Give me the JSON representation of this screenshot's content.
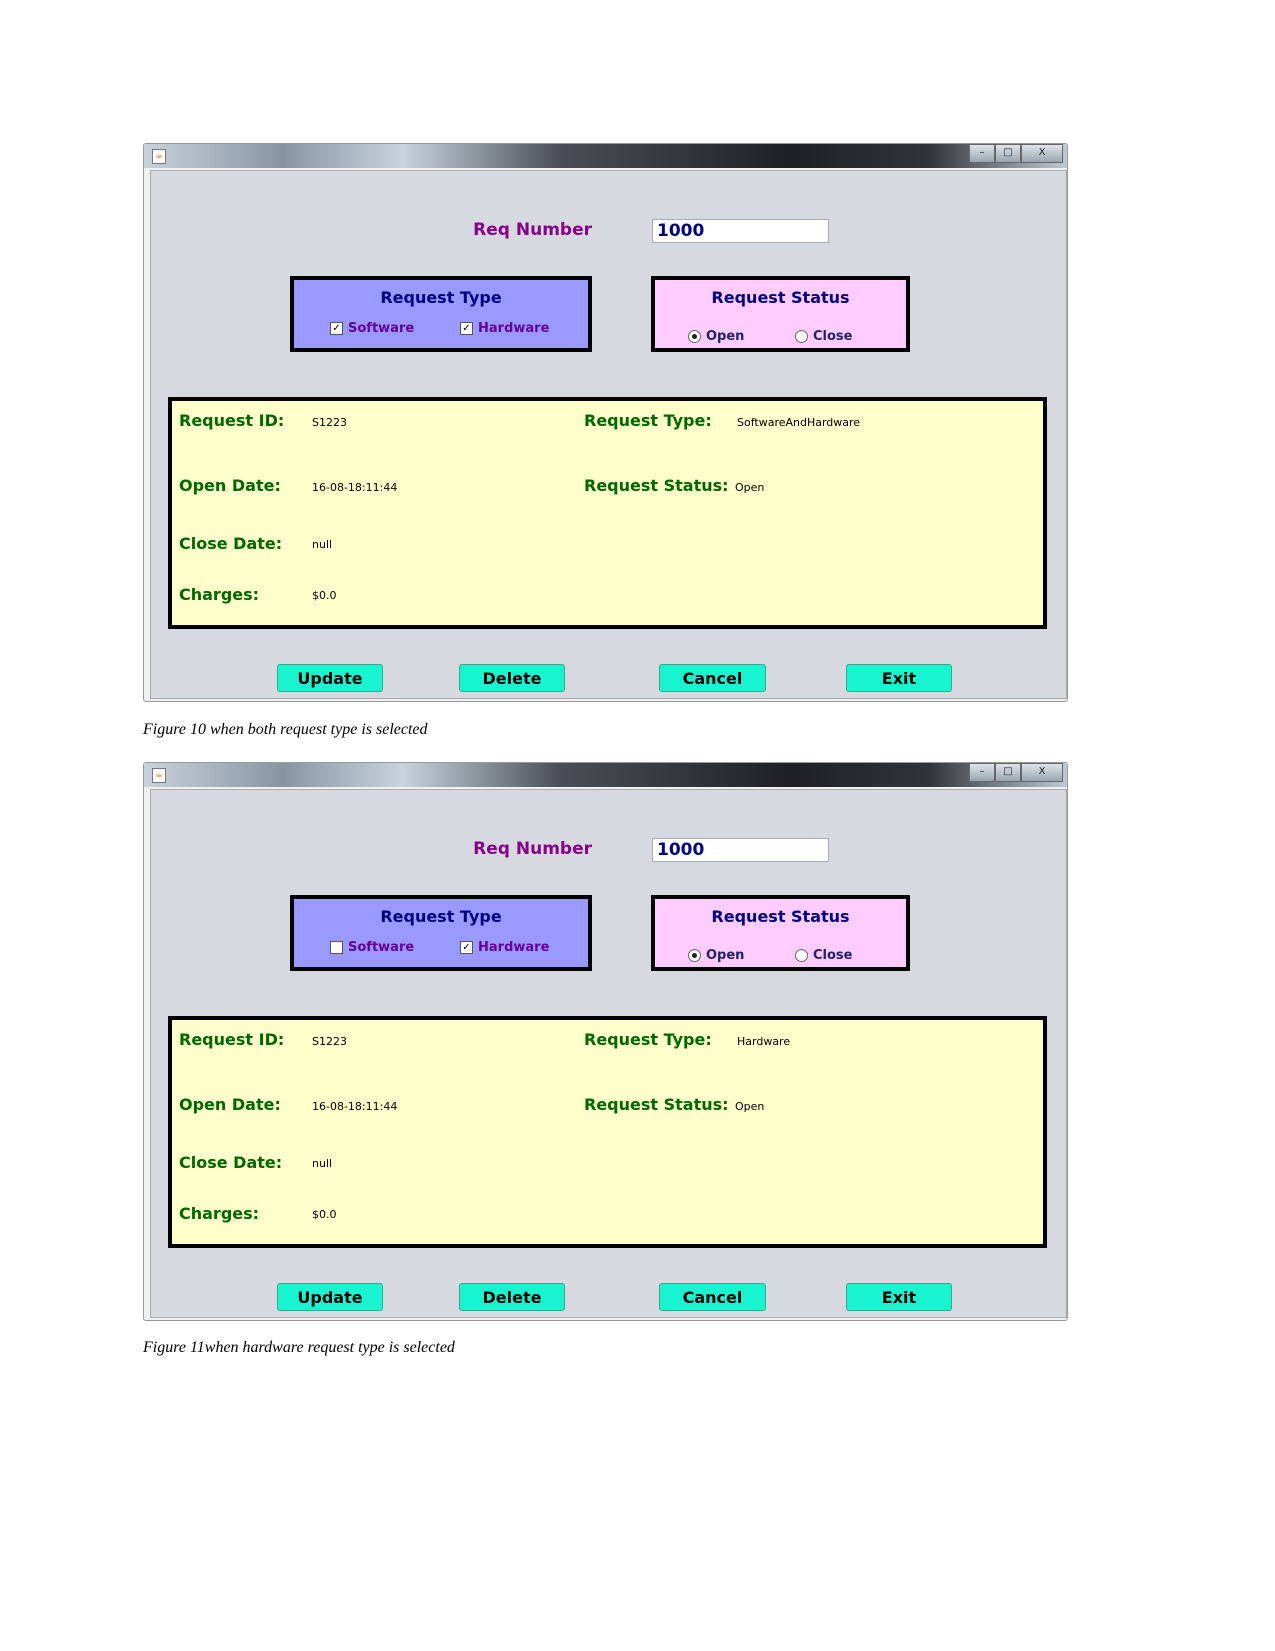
{
  "figures": [
    {
      "caption": "Figure 10 when both request type is selected",
      "req_number_label": "Req Number",
      "req_number_value": "1000",
      "request_type": {
        "title": "Request Type",
        "software_label": "Software",
        "software_checked": true,
        "hardware_label": "Hardware",
        "hardware_checked": true
      },
      "request_status": {
        "title": "Request Status",
        "open_label": "Open",
        "open_selected": true,
        "close_label": "Close",
        "close_selected": false
      },
      "details": {
        "request_id_label": "Request ID:",
        "request_id": "S1223",
        "open_date_label": "Open Date:",
        "open_date": "16-08-18:11:44",
        "close_date_label": "Close Date:",
        "close_date": "null",
        "charges_label": "Charges:",
        "charges": "$0.0",
        "request_type_label": "Request Type:",
        "request_type": "SoftwareAndHardware",
        "request_status_label": "Request Status:",
        "request_status": "Open"
      },
      "buttons": {
        "update": "Update",
        "delete": "Delete",
        "cancel": "Cancel",
        "exit": "Exit"
      }
    },
    {
      "caption": "Figure 11when hardware request type is selected",
      "req_number_label": "Req Number",
      "req_number_value": "1000",
      "request_type": {
        "title": "Request Type",
        "software_label": "Software",
        "software_checked": false,
        "hardware_label": "Hardware",
        "hardware_checked": true
      },
      "request_status": {
        "title": "Request Status",
        "open_label": "Open",
        "open_selected": true,
        "close_label": "Close",
        "close_selected": false
      },
      "details": {
        "request_id_label": "Request ID:",
        "request_id": "S1223",
        "open_date_label": "Open Date:",
        "open_date": "16-08-18:11:44",
        "close_date_label": "Close Date:",
        "close_date": "null",
        "charges_label": "Charges:",
        "charges": "$0.0",
        "request_type_label": "Request Type:",
        "request_type": "Hardware",
        "request_status_label": "Request Status:",
        "request_status": "Open"
      },
      "buttons": {
        "update": "Update",
        "delete": "Delete",
        "cancel": "Cancel",
        "exit": "Exit"
      }
    }
  ],
  "window_controls": {
    "minimize": "–",
    "maximize": "□",
    "close": "X"
  },
  "colors": {
    "button": "#19f5d0",
    "request_type_bg": "#9999ff",
    "request_status_bg": "#ffccff",
    "details_bg": "#ffffcc",
    "detail_label": "#006600",
    "req_label": "#880088"
  }
}
